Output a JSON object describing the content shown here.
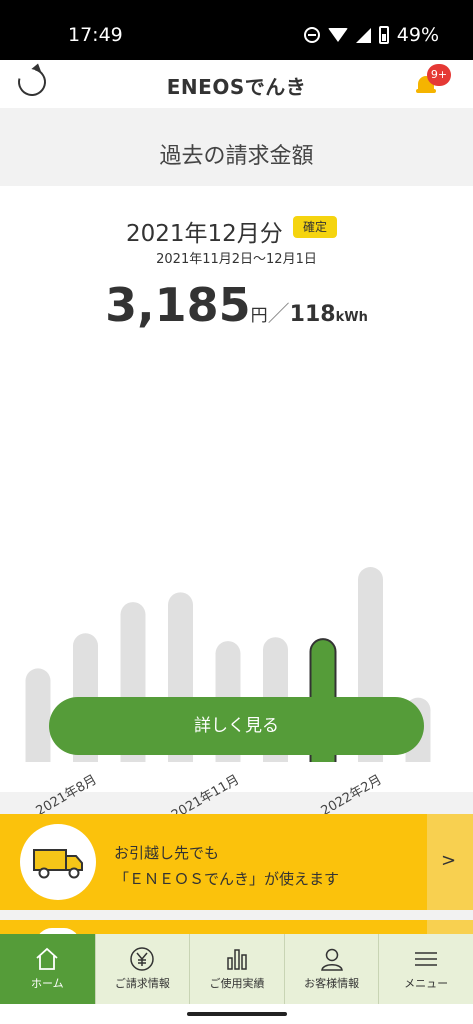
{
  "status_bar": {
    "time": "17:49",
    "battery": "49%"
  },
  "header": {
    "logo": "ENEOSでんき",
    "notification_badge": "9+"
  },
  "page": {
    "title": "過去の請求金額"
  },
  "bill": {
    "month": "2021年12月分",
    "status": "確定",
    "period": "2021年11月2日〜12月1日",
    "amount": "3,185",
    "amount_unit": "円",
    "separator": "／",
    "usage": "118",
    "usage_unit": "kWh"
  },
  "chart_data": {
    "type": "bar",
    "bar_count": 9,
    "relative_values": [
      0.48,
      0.66,
      0.82,
      0.87,
      0.62,
      0.64,
      0.63,
      1.0,
      0.33
    ],
    "selected_index": 6,
    "visible_tick_labels": [
      {
        "bar_index": 1,
        "label": "2021年8月"
      },
      {
        "bar_index": 4,
        "label": "2021年11月"
      },
      {
        "bar_index": 7,
        "label": "2022年2月"
      }
    ],
    "colors": {
      "bar": "#e0e0e0",
      "selected": "#559c39",
      "selected_outline": "#333333"
    }
  },
  "actions": {
    "details_button": "詳しく見る"
  },
  "promo": {
    "line1": "お引越し先でも",
    "line2": "「ＥＮＥＯＳでんき」が使えます",
    "arrow": ">"
  },
  "nav": {
    "items": [
      {
        "label": "ホーム",
        "icon": "home-icon"
      },
      {
        "label": "ご請求情報",
        "icon": "yen-icon"
      },
      {
        "label": "ご使用実績",
        "icon": "bar-chart-icon"
      },
      {
        "label": "お客様情報",
        "icon": "person-icon"
      },
      {
        "label": "メニュー",
        "icon": "menu-icon"
      }
    ]
  },
  "colors": {
    "accent_green": "#559c39",
    "promo_yellow": "#fbc20c",
    "badge_yellow": "#f5d40f",
    "alert_red": "#e53935"
  }
}
